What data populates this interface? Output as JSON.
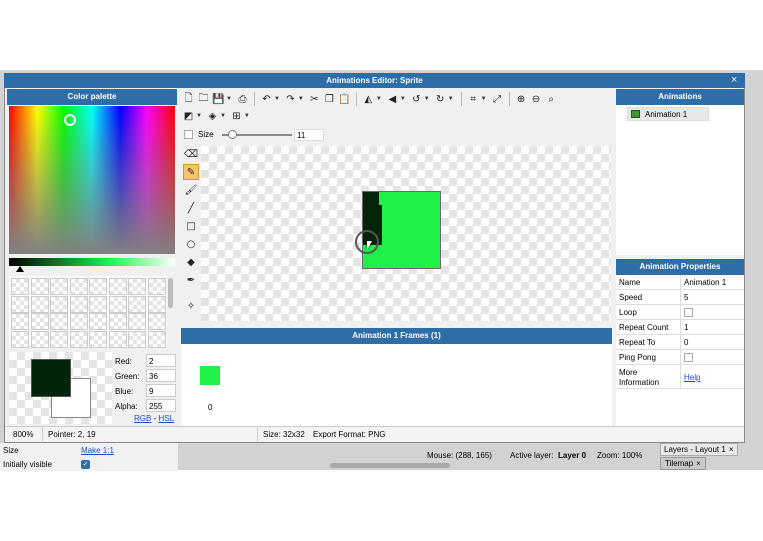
{
  "window": {
    "title": "Animations Editor: Sprite",
    "close": "×"
  },
  "palette": {
    "title": "Color palette",
    "values": {
      "red_label": "Red:",
      "red": "2",
      "green_label": "Green:",
      "green": "36",
      "blue_label": "Blue:",
      "blue": "9",
      "alpha_label": "Alpha:",
      "alpha": "255"
    },
    "rgb_link": "RGB",
    "hsl_link": "HSL",
    "sep": " - ",
    "primary_color": "#022409"
  },
  "size_control": {
    "label": "Size",
    "value": "11"
  },
  "frames": {
    "title": "Animation 1 Frames (1)",
    "frame_label": "0"
  },
  "animations_panel": {
    "title": "Animations",
    "item": "Animation 1"
  },
  "properties": {
    "title": "Animation Properties",
    "rows": [
      {
        "key": "Name",
        "value": "Animation 1"
      },
      {
        "key": "Speed",
        "value": "5"
      },
      {
        "key": "Loop",
        "value": ""
      },
      {
        "key": "Repeat Count",
        "value": "1"
      },
      {
        "key": "Repeat To",
        "value": "0"
      },
      {
        "key": "Ping Pong",
        "value": ""
      }
    ],
    "more_key": "More Information",
    "more_value": "Help"
  },
  "status": {
    "zoom": "800%",
    "pointer": "Pointer: 2, 19",
    "size": "Size: 32x32",
    "export": "Export Format: PNG"
  },
  "background": {
    "size_label": "Size",
    "make_link": "Make 1:1",
    "visible_label": "Initially visible",
    "mouse": "Mouse: (288, 165)",
    "active_layer_prefix": "Active layer:",
    "active_layer": "Layer 0",
    "zoom": "Zoom: 100%",
    "tab_layers": "Layers - Layout 1",
    "tab_tilemap": "Tilemap",
    "close": "×"
  },
  "colors": {
    "header": "#2e6ea8",
    "sprite_green": "#1ff247",
    "dark": "#022409"
  }
}
